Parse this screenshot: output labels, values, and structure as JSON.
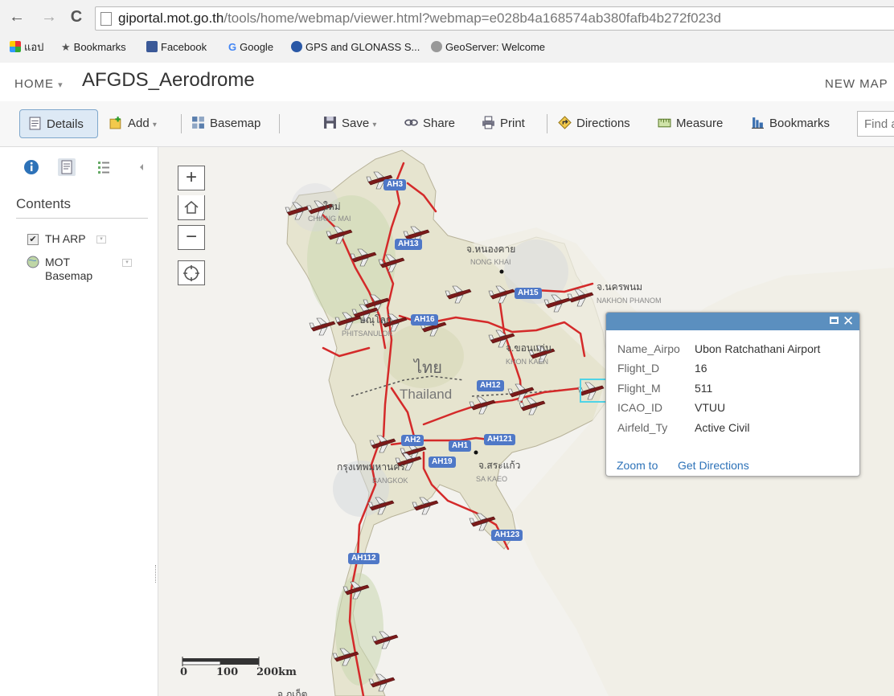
{
  "browser": {
    "back": "←",
    "forward": "→",
    "reload": "C",
    "url_host": "giportal.mot.go.th",
    "url_path": "/tools/home/webmap/viewer.html?webmap=e028b4a168574ab380fafb4b272f023d",
    "bookmarks": [
      "แอป",
      "Bookmarks",
      "Facebook",
      "Google",
      "GPS and GLONASS S...",
      "GeoServer: Welcome"
    ]
  },
  "header": {
    "home": "HOME",
    "home_caret": "▾",
    "title": "AFGDS_Aerodrome",
    "new_map": "NEW MAP"
  },
  "toolbar": {
    "details": "Details",
    "add": "Add",
    "basemap": "Basemap",
    "save": "Save",
    "share": "Share",
    "print": "Print",
    "directions": "Directions",
    "measure": "Measure",
    "bookmarks": "Bookmarks",
    "find_placeholder": "Find a"
  },
  "panel": {
    "contents_title": "Contents",
    "layers": [
      {
        "name": "TH ARP",
        "checked": true
      },
      {
        "name": "MOT Basemap",
        "line1": "MOT",
        "line2": "Basemap",
        "checked": false
      }
    ]
  },
  "map": {
    "zoom_in": "+",
    "zoom_out": "−",
    "cities": [
      {
        "th": "ใหม่",
        "en": "CHIANG MAI"
      },
      {
        "th": "จ.หนองคาย",
        "en": "NONG KHAI"
      },
      {
        "th": "จ.นครพนม",
        "en": "NAKHON PHANOM"
      },
      {
        "th": "ษณุโลก",
        "en": "PHITSANULOK"
      },
      {
        "th": "จ.ขอนแก่น",
        "en": "KHON KAEN"
      },
      {
        "th": "กรุงเทพมหานคร",
        "en": "BANGKOK"
      },
      {
        "th": "จ.สระแก้ว",
        "en": "SA KAEO"
      },
      {
        "th": "จ.ภูเก็ต",
        "en": ""
      }
    ],
    "country_th": "ไทย",
    "country_en": "Thailand",
    "highways": [
      "AH3",
      "AH13",
      "AH15",
      "AH16",
      "AH12",
      "AH2",
      "AH1",
      "AH121",
      "AH19",
      "AH123",
      "AH112"
    ],
    "scale_labels": [
      "0",
      "100",
      "200km"
    ]
  },
  "popup": {
    "fields": [
      {
        "key": "Name_Airpo",
        "value": "Ubon Ratchathani Airport"
      },
      {
        "key": "Flight_D",
        "value": "16"
      },
      {
        "key": "Flight_M",
        "value": "511"
      },
      {
        "key": "ICAO_ID",
        "value": "VTUU"
      },
      {
        "key": "Airfeld_Ty",
        "value": "Active Civil"
      }
    ],
    "zoom_to": "Zoom to",
    "get_directions": "Get Directions",
    "close": "✕"
  },
  "colors": {
    "road": "#d42a2a",
    "land": "#e9e6d4",
    "popup_bar": "#5b8fbf",
    "shield": "#4f78c7",
    "link": "#2d72b8"
  }
}
